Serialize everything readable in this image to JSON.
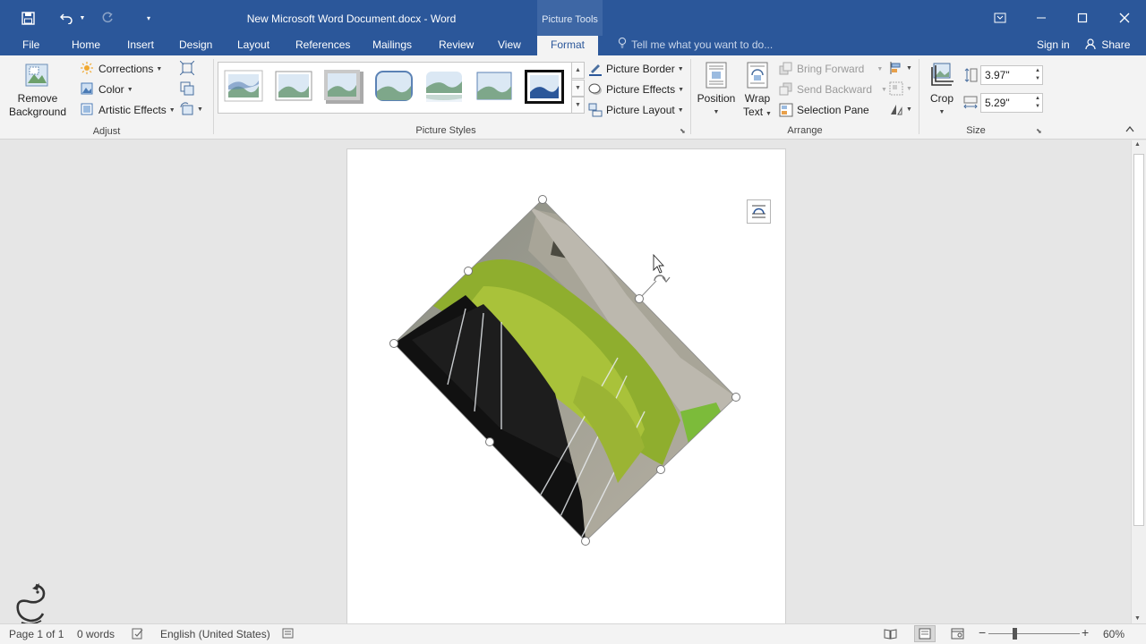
{
  "window": {
    "doc_title": "New Microsoft Word Document.docx - Word",
    "context_tab_title": "Picture Tools"
  },
  "tabs": [
    "File",
    "Home",
    "Insert",
    "Design",
    "Layout",
    "References",
    "Mailings",
    "Review",
    "View",
    "Format"
  ],
  "active_tab": "Format",
  "tell_me": "Tell me what you want to do...",
  "sign_in": "Sign in",
  "share": "Share",
  "ribbon": {
    "adjust": {
      "label": "Adjust",
      "remove_background_1": "Remove",
      "remove_background_2": "Background",
      "corrections": "Corrections",
      "color": "Color",
      "artistic_effects": "Artistic Effects"
    },
    "picture_styles": {
      "label": "Picture Styles",
      "picture_border": "Picture Border",
      "picture_effects": "Picture Effects",
      "picture_layout": "Picture Layout"
    },
    "arrange": {
      "label": "Arrange",
      "position": "Position",
      "wrap_text_1": "Wrap",
      "wrap_text_2": "Text",
      "bring_forward": "Bring Forward",
      "send_backward": "Send Backward",
      "selection_pane": "Selection Pane"
    },
    "size": {
      "label": "Size",
      "crop": "Crop",
      "height": "3.97\"",
      "width": "5.29\""
    }
  },
  "status": {
    "page": "Page 1 of 1",
    "words": "0 words",
    "language": "English (United States)",
    "zoom": "60%"
  },
  "colors": {
    "title_bar": "#2b579a",
    "ribbon": "#f3f3f3",
    "document_background": "#e6e6e6"
  }
}
